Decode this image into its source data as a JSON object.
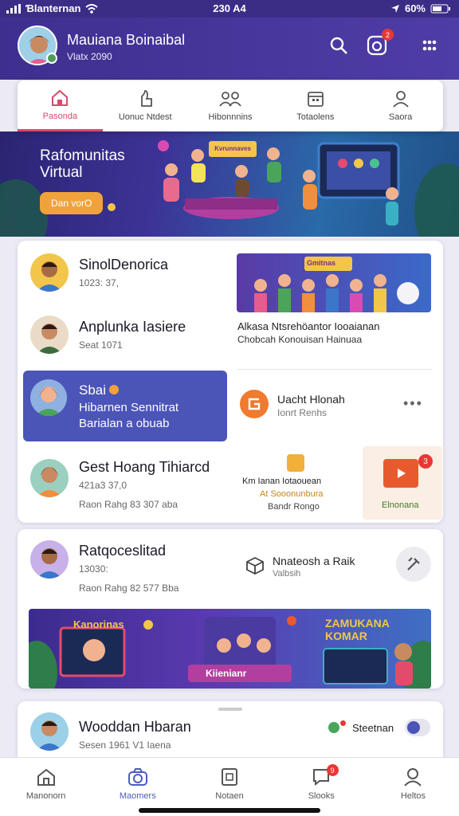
{
  "status_bar": {
    "carrier": "Ɓlanternan",
    "time": "230 A4",
    "battery": "60%"
  },
  "header": {
    "name": "Mauiana Boinaibal",
    "subtitle": "Vlatx 2090",
    "notification_count": "2"
  },
  "tabs": [
    {
      "label": "Pasonda",
      "icon": "home-icon"
    },
    {
      "label": "Uonuc Ntdest",
      "icon": "thumb-icon"
    },
    {
      "label": "Hibonnnins",
      "icon": "people-icon"
    },
    {
      "label": "Totaolens",
      "icon": "calendar-icon"
    },
    {
      "label": "Saora",
      "icon": "user-icon"
    }
  ],
  "banner": {
    "title": "Rafomunitas Virtual",
    "button": "Dan vorO",
    "poster": "Kvrunnaves"
  },
  "feed": {
    "row1": {
      "name": "SinolDenorica",
      "meta": "1023: 37,",
      "thumb_label": "Gmitnas"
    },
    "row2": {
      "name": "Anplunka Iasiere",
      "meta": "Seat 1071",
      "text1": "Alkasa Ntsrehöantor Iooaianan",
      "text2": "Chobcah Konouisan Hainuaa"
    },
    "row3": {
      "name": "Sbai",
      "line1": "Hibarnen Sennitrat",
      "line2": "Barialan a obuab",
      "side_title": "Uacht Hlonah",
      "side_sub": "Ionrt Renhs"
    },
    "row4": {
      "name": "Gest Hoang Tihiarcd",
      "meta": "421a3 37,0",
      "meta2": "Raon Rahg 83 307 aba",
      "text1": "Km Ianan Iotaouean",
      "text2": "At Sooonunbura",
      "text3": "Bandr Rongo",
      "thumb_label": "Elnonana",
      "thumb_badge": "3"
    },
    "row5": {
      "name": "Ratqoceslitad",
      "meta": "13030:",
      "meta2": "Raon Rahg 82 577 Bba",
      "side": "Nnateosh a Raik",
      "side_sub": "Valbsih",
      "poster_left": "Kanorinas",
      "poster_center": "Kiienianr",
      "poster_right": "ZAMUKANA KOMAR"
    },
    "row6": {
      "name": "Wooddan Hbaran",
      "meta": "Sesen 1961 V1 Iaena",
      "side": "Steetnan"
    }
  },
  "bottom_nav": [
    {
      "label": "Manonorn",
      "icon": "home-icon"
    },
    {
      "label": "Maomers",
      "icon": "camera-icon"
    },
    {
      "label": "Notaen",
      "icon": "document-icon"
    },
    {
      "label": "Slooks",
      "icon": "chat-icon",
      "badge": "9"
    },
    {
      "label": "Heltos",
      "icon": "profile-icon"
    }
  ]
}
